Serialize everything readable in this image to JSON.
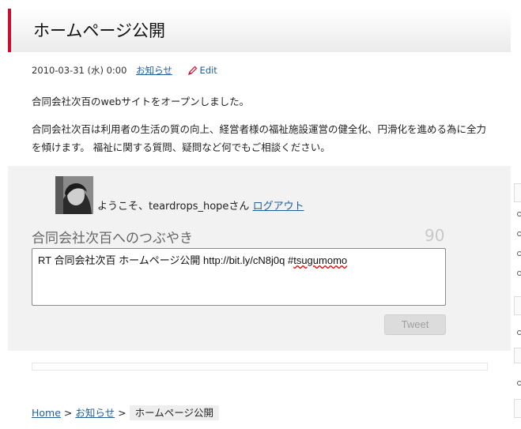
{
  "post": {
    "title": "ホームページ公開",
    "date": "2010-03-31 (水) 0:00",
    "category": "お知らせ",
    "edit": "Edit",
    "paragraph1": "合同会社次百のwebサイトをオープンしました。",
    "paragraph2": "合同会社次百は利用者の生活の質の向上、経営者様の福祉施設運営の健全化、円滑化を進める為に全力を傾けます。 福祉に関する質問、疑問など何でもご相談ください。"
  },
  "tweet": {
    "welcome": "ようこそ、teardrops_hopeさん",
    "logout": "ログアウト",
    "heading": "合同会社次百へのつぶやき",
    "remaining": "90",
    "text_before": "RT 合同会社次百 ホームページ公開 http://bit.ly/cN8j0q #",
    "text_misspelled": "tsugumomo",
    "button": "Tweet"
  },
  "breadcrumb": {
    "home": "Home",
    "sep": ">",
    "category": "お知らせ",
    "current": "ホームページ公開"
  },
  "colors": {
    "accent": "#c8102e",
    "link": "#1f5f9c"
  }
}
